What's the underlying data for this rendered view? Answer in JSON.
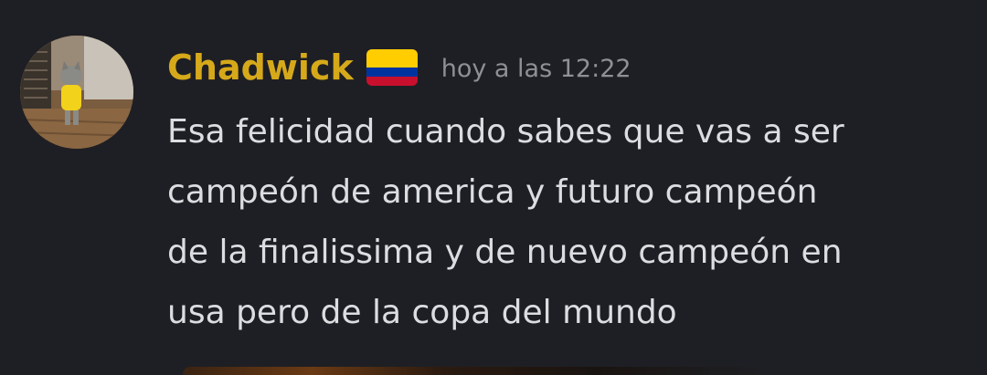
{
  "message": {
    "author": "Chadwick",
    "author_flag": "colombia-flag",
    "timestamp": "hoy a las 12:22",
    "content_lines": [
      "Esa felicidad cuando sabes que vas a ser",
      "campeón de america y futuro campeón",
      "de la finalissima y de nuevo campeón en",
      "usa pero de la copa del mundo"
    ]
  },
  "colors": {
    "background": "#1e1f24",
    "username": "#d6a91a",
    "timestamp": "#8e9097",
    "text": "#dcdde1"
  }
}
